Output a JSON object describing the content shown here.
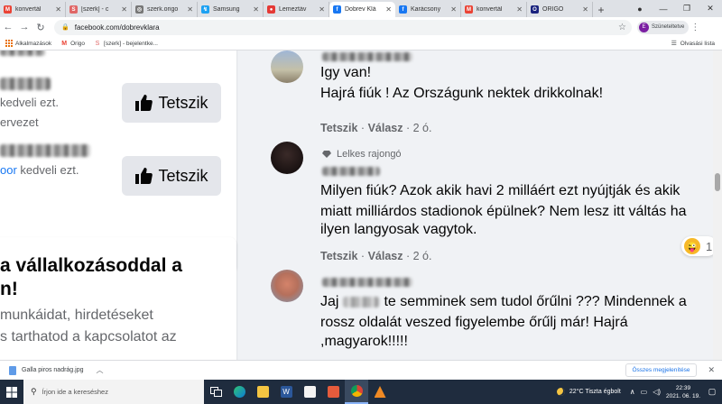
{
  "browser": {
    "tabs": [
      {
        "label": "konvertál",
        "color": "#ea4335",
        "glyph": "M"
      },
      {
        "label": "[szerk] - c",
        "color": "#e06666",
        "glyph": "S"
      },
      {
        "label": "szerk.origo",
        "color": "#777777",
        "glyph": "◎"
      },
      {
        "label": "Samsung",
        "color": "#1da1f2",
        "glyph": "↯"
      },
      {
        "label": "Lemeztáv",
        "color": "#e53935",
        "glyph": "●"
      },
      {
        "label": "Dobrev Klá",
        "color": "#1877f2",
        "glyph": "f",
        "active": true
      },
      {
        "label": "Karácsony",
        "color": "#1877f2",
        "glyph": "f"
      },
      {
        "label": "konvertál",
        "color": "#ea4335",
        "glyph": "M"
      },
      {
        "label": "ORIGO",
        "color": "#1a237e",
        "glyph": "O"
      }
    ],
    "new_tab_label": "+",
    "url": "facebook.com/dobrevklara",
    "profile_initial": "E",
    "profile_label": "Szüneteltetve",
    "bookmarks": [
      {
        "label": "Alkalmazások",
        "icon": "apps-grid-icon"
      },
      {
        "label": "Origo",
        "icon": "gmail-icon"
      },
      {
        "label": "[szerk] - bejelentke...",
        "icon": "bookmark-icon"
      }
    ],
    "reading_list": "Olvasási lista"
  },
  "left_panel": {
    "items": [
      {
        "line1_suffix": "kedveli ezt.",
        "line2": "ervezet",
        "like_label": "Tetszik"
      },
      {
        "line1_link": "oor",
        "line1_suffix": "kedveli ezt.",
        "like_label": "Tetszik"
      }
    ],
    "promo_title_line1": "a vállalkozásoddal a",
    "promo_title_line2": "n!",
    "promo_text_line1": "munkáidat, hirdetéseket",
    "promo_text_line2": "s tarthatod a kapcsolatot az"
  },
  "comments": [
    {
      "lines": [
        "Igy van!",
        "Hajrá fiúk ! Az Országunk nektek drikkolnak!"
      ],
      "like": "Tetszik",
      "reply": "Válasz",
      "time": "2 ó."
    },
    {
      "badge": "Lelkes rajongó",
      "lines": [
        "Milyen fiúk? Azok akik havi 2 milláért ezt nyújtják és akik",
        "miatt milliárdos stadionok épülnek? Nem lesz itt váltás ha",
        "ilyen langyosak vagytok."
      ],
      "like": "Tetszik",
      "reply": "Válasz",
      "time": "2 ó.",
      "reaction_count": "1"
    },
    {
      "line1_prefix": "Jaj",
      "line1_suffix": "te semminek sem tudol őrűlni ??? Mindennek a",
      "lines": [
        "rossz oldalát veszed figyelembe őrűlj már! Hajrá",
        ",magyarok!!!!!"
      ]
    }
  ],
  "download": {
    "filename": "Galla piros nadrág.jpg",
    "show_all": "Összes megjelenítése"
  },
  "taskbar": {
    "search_placeholder": "Írjon ide a kereséshez",
    "weather": "22°C  Tiszta égbolt",
    "time": "22:39",
    "date": "2021. 06. 19."
  }
}
